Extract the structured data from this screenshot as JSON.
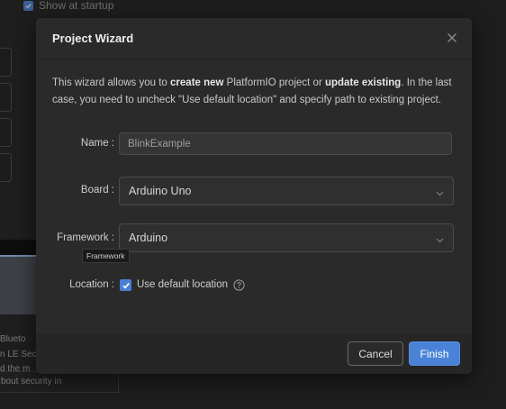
{
  "background": {
    "show_at_startup_label": "Show at startup",
    "show_at_startup_checked": true,
    "side_text_lines": [
      "Blueto",
      "n LE Sec",
      "d the m",
      "bout security in"
    ]
  },
  "dialog": {
    "title": "Project Wizard",
    "close_icon": "close-icon",
    "description": {
      "part1": "This wizard allows you to ",
      "bold1": "create new",
      "part2": " PlatformIO project or ",
      "bold2": "update existing",
      "part3": ". In the last case, you need to uncheck \"Use default location\" and specify path to existing project."
    },
    "fields": {
      "name": {
        "label": "Name",
        "value": "BlinkExample"
      },
      "board": {
        "label": "Board",
        "value": "Arduino Uno"
      },
      "framework": {
        "label": "Framework",
        "value": "Arduino",
        "tooltip": "Framework"
      },
      "location": {
        "label": "Location",
        "checkbox_label": "Use default location",
        "checked": true
      }
    },
    "buttons": {
      "cancel": "Cancel",
      "finish": "Finish"
    }
  },
  "colors": {
    "accent": "#4a82d8",
    "dialog_bg": "#2a2a2b",
    "backdrop": "#1e1e1f"
  }
}
